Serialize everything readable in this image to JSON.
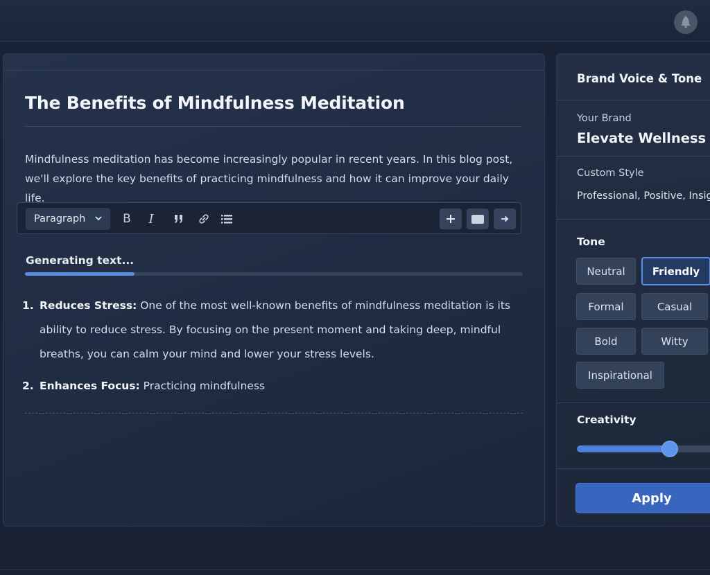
{
  "colors": {
    "accent": "#5b8fe6",
    "background": "#182234",
    "panel": "#232f45",
    "apply": "#3866be"
  },
  "header": {
    "notification_icon": "bell-icon"
  },
  "editor": {
    "title": "The Benefits of Mindfulness Meditation",
    "intro": "Mindfulness meditation has become increasingly popular in recent years. In this blog post, we'll explore the key benefits of practicing mindfulness and how it can improve your daily life.",
    "toolbar": {
      "block_type": "Paragraph",
      "icons": [
        "bold-icon",
        "italic-icon",
        "quote-icon",
        "link-icon",
        "list-icon",
        "plus-icon",
        "image-icon",
        "arrow-right-icon"
      ]
    },
    "generating_label": "Generating text...",
    "progress": 0.22,
    "items": [
      {
        "num": "1.",
        "heading": "Reduces Stress:",
        "text": " One of the most well-known benefits of mindfulness meditation is its ability to reduce stress. By focusing on the present moment and taking deep, mindful breaths, you can calm your mind and lower your stress levels."
      },
      {
        "num": "2.",
        "heading": "Enhances Focus:",
        "text": " Practicing mindfulness"
      }
    ]
  },
  "panel": {
    "title": "Brand Voice & Tone",
    "brand_label": "Your Brand",
    "brand_name": "Elevate Wellness",
    "style_label": "Custom Style",
    "style_value": "Professional, Positive, Insightful",
    "tone_label": "Tone",
    "tones": [
      "Neutral",
      "Friendly",
      "Formal",
      "Casual",
      "Bold",
      "Witty",
      "Inspirational"
    ],
    "selected_tone": "Friendly",
    "creativity_label": "Creativity",
    "creativity": 0.61,
    "apply_label": "Apply"
  }
}
